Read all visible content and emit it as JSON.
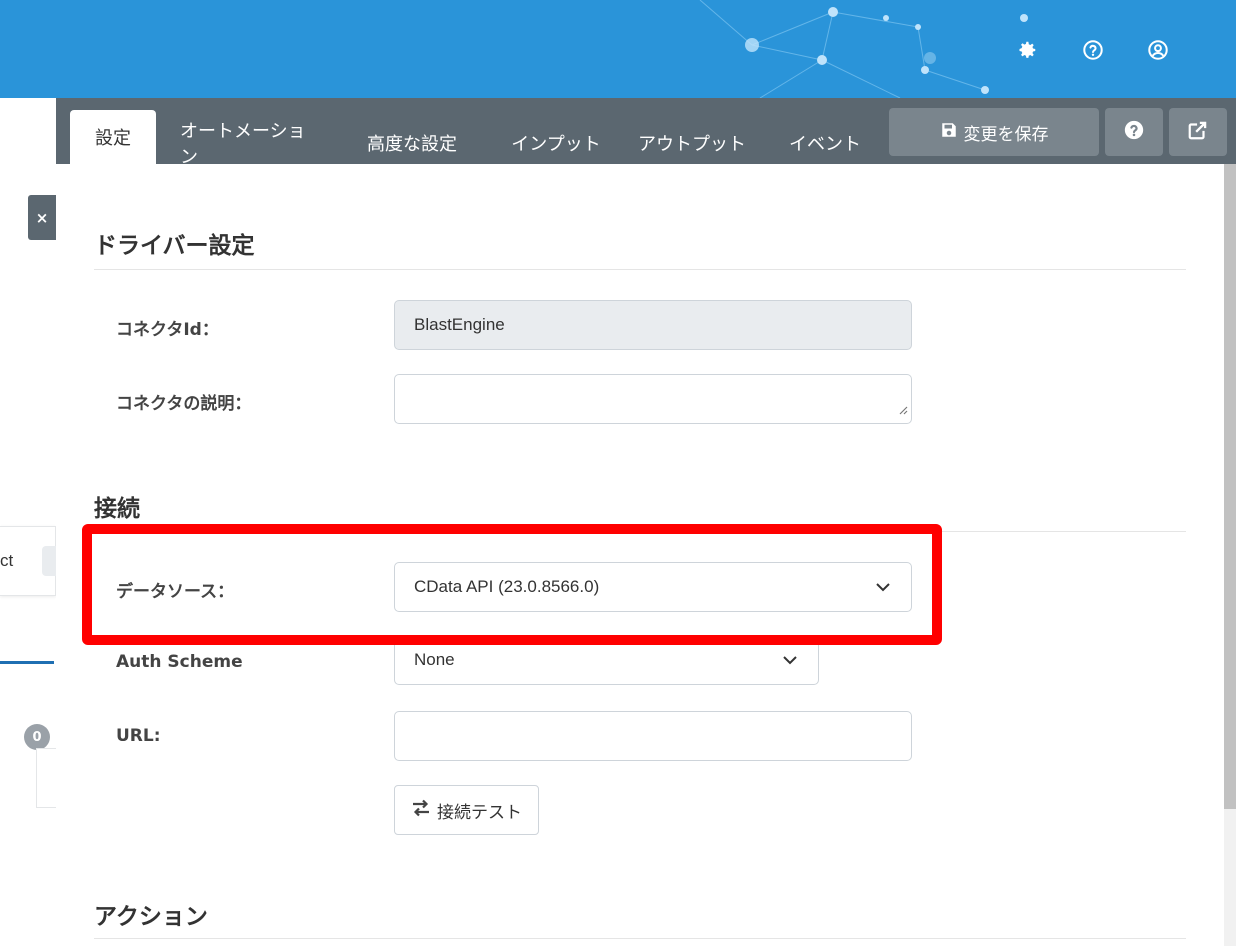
{
  "header": {
    "icons": [
      "gear-icon",
      "help-circle-icon",
      "user-circle-icon"
    ]
  },
  "left_panel": {
    "close_label": "×",
    "card_text": "ct",
    "badge_count": "0"
  },
  "tabs": [
    {
      "label": "設定",
      "active": true
    },
    {
      "label": "オートメーション",
      "active": false
    },
    {
      "label": "高度な設定",
      "active": false
    },
    {
      "label": "インプット",
      "active": false
    },
    {
      "label": "アウトプット",
      "active": false
    },
    {
      "label": "イベント",
      "active": false
    }
  ],
  "toolbar": {
    "save_label": "変更を保存",
    "help_label": "?"
  },
  "driver_section": {
    "title": "ドライバー設定",
    "connector_id_label": "コネクタId：",
    "connector_id_value": "BlastEngine",
    "description_label": "コネクタの説明：",
    "description_value": ""
  },
  "connection_section": {
    "title": "接続",
    "datasource_label": "データソース：",
    "datasource_value": "CData API (23.0.8566.0)",
    "auth_label": "Auth Scheme",
    "auth_value": "None",
    "url_label": "URL:",
    "url_value": "",
    "test_button_label": "接続テスト"
  },
  "action_section": {
    "title": "アクション"
  },
  "colors": {
    "header_bg": "#2a94d9",
    "tabbar_bg": "#5b6770",
    "highlight": "#ff0000"
  }
}
